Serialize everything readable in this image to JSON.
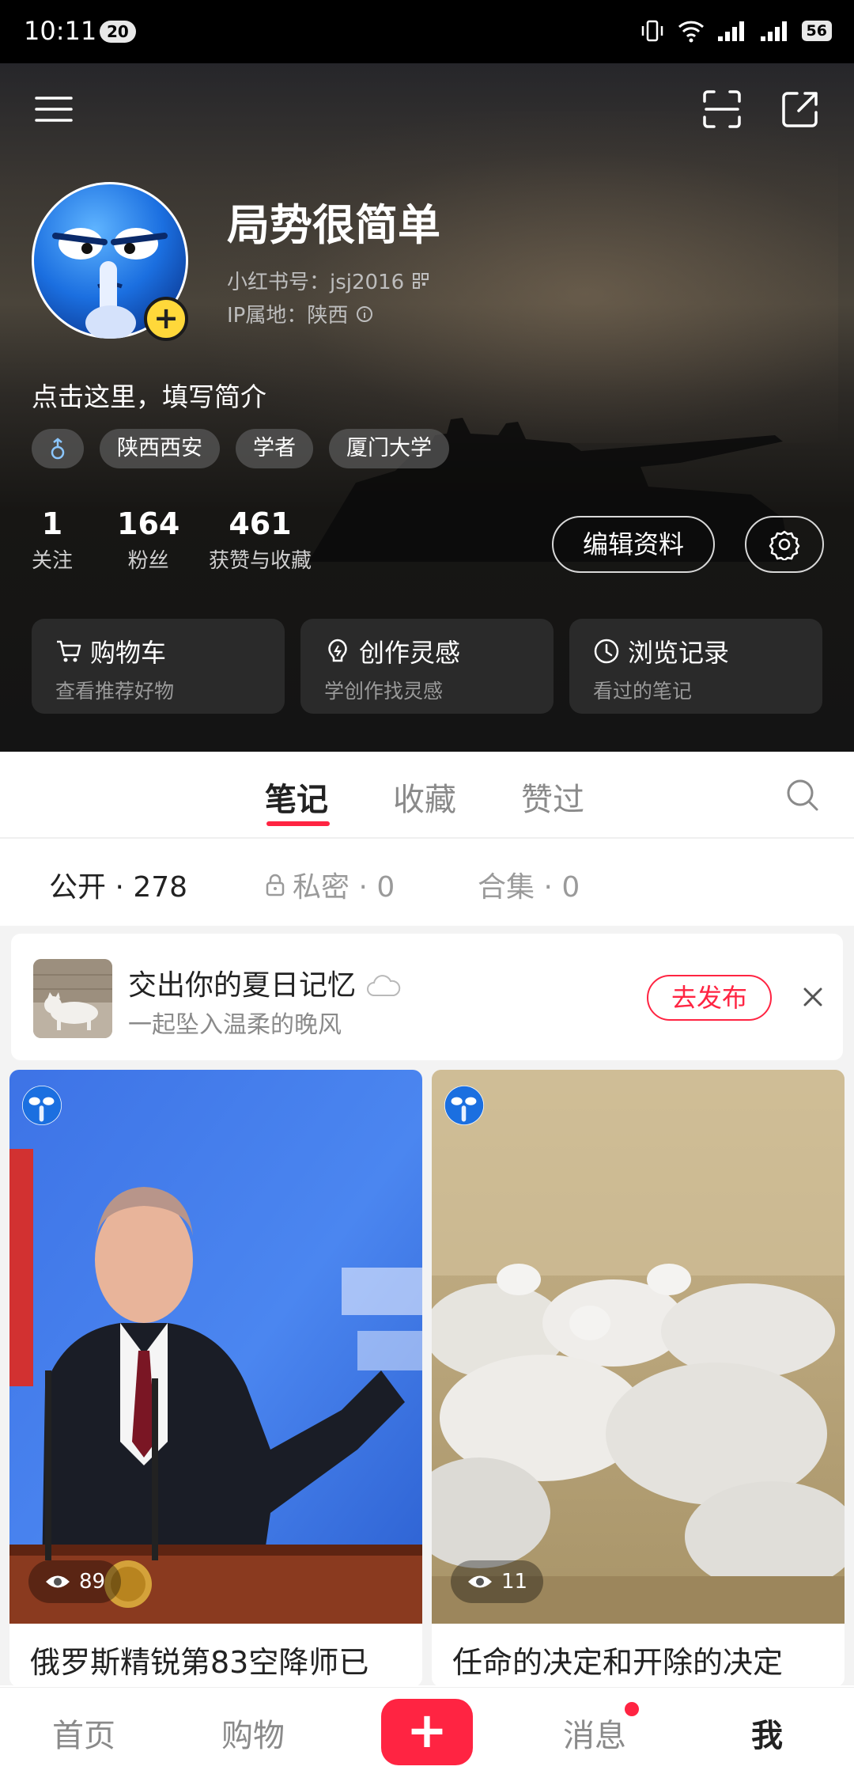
{
  "status_bar": {
    "time": "10:11",
    "notification_count": "20",
    "battery": "56"
  },
  "profile": {
    "username": "局势很简单",
    "id_label": "小红书号：jsj2016",
    "ip_label": "IP属地：陕西",
    "bio": "点击这里，填写简介",
    "tags": [
      "陕西西安",
      "学者",
      "厦门大学"
    ],
    "stats": [
      {
        "value": "1",
        "label": "关注"
      },
      {
        "value": "164",
        "label": "粉丝"
      },
      {
        "value": "461",
        "label": "获赞与收藏"
      }
    ],
    "edit_label": "编辑资料"
  },
  "shortcuts": [
    {
      "title": "购物车",
      "subtitle": "查看推荐好物",
      "icon": "cart-icon"
    },
    {
      "title": "创作灵感",
      "subtitle": "学创作找灵感",
      "icon": "bulb-icon"
    },
    {
      "title": "浏览记录",
      "subtitle": "看过的笔记",
      "icon": "clock-icon"
    }
  ],
  "tabs": [
    "笔记",
    "收藏",
    "赞过"
  ],
  "subtabs": [
    {
      "label": "公开 · 278"
    },
    {
      "label": "私密 · 0"
    },
    {
      "label": "合集 · 0"
    }
  ],
  "promo": {
    "title": "交出你的夏日记忆",
    "subtitle": "一起坠入温柔的晚风",
    "button": "去发布"
  },
  "notes": [
    {
      "title": "俄罗斯精锐第83空降师已",
      "views": "89"
    },
    {
      "title": "任命的决定和开除的决定",
      "views": "11"
    }
  ],
  "bottom_nav": [
    "首页",
    "购物",
    "消息",
    "我"
  ],
  "colors": {
    "accent": "#ff2442",
    "avatar_yellow": "#ffd83a"
  }
}
